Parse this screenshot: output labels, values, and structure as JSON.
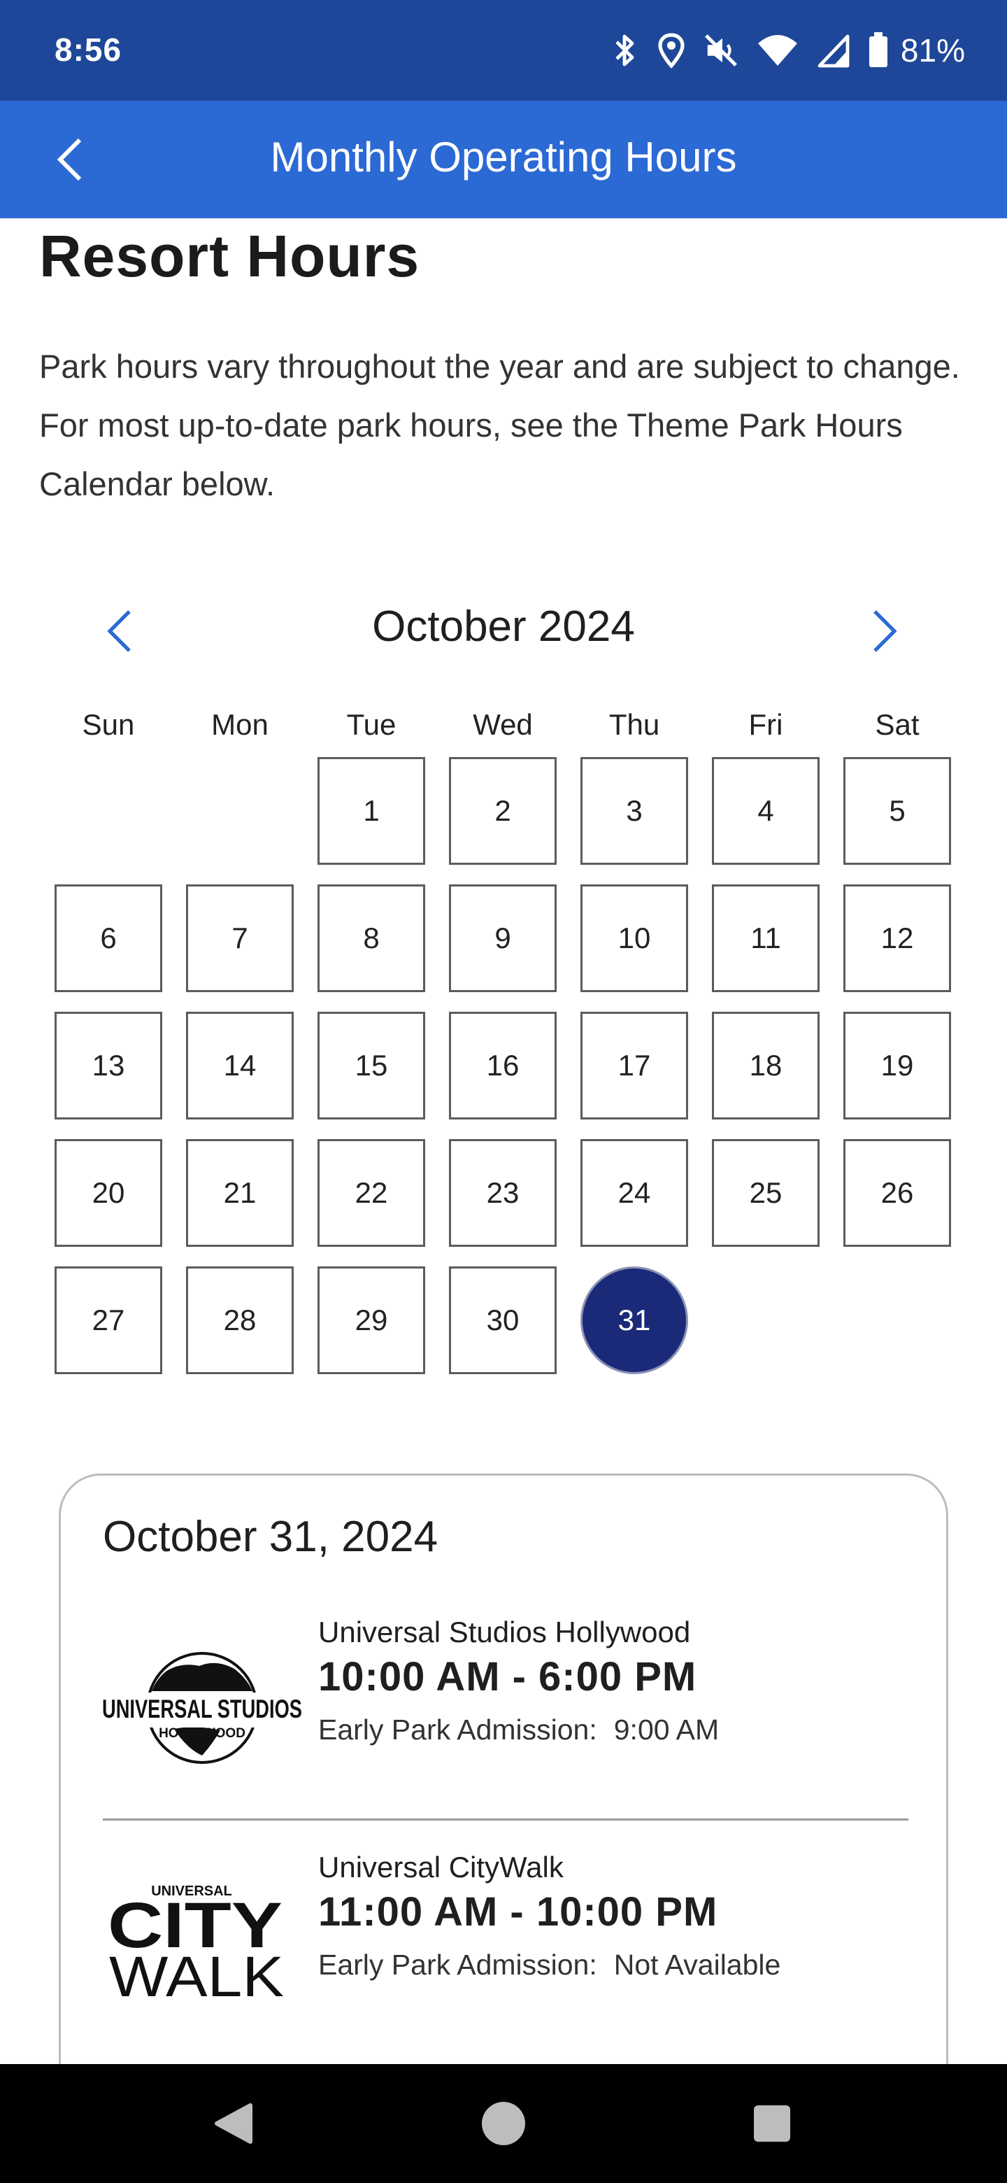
{
  "status_bar": {
    "time": "8:56",
    "battery": "81%",
    "icons": [
      "bluetooth-icon",
      "location-icon",
      "mute-icon",
      "wifi-icon",
      "signal-icon",
      "battery-icon"
    ]
  },
  "header": {
    "title": "Monthly Operating Hours",
    "back_icon": "chevron-left-icon"
  },
  "resort": {
    "title": "Resort Hours",
    "description": "Park hours vary throughout the year and are subject to change. For most up-to-date park hours, see the Theme Park Hours Calendar below."
  },
  "calendar": {
    "month_label": "October 2024",
    "weekdays": [
      "Sun",
      "Mon",
      "Tue",
      "Wed",
      "Thu",
      "Fri",
      "Sat"
    ],
    "first_weekday_index": 2,
    "days": [
      "1",
      "2",
      "3",
      "4",
      "5",
      "6",
      "7",
      "8",
      "9",
      "10",
      "11",
      "12",
      "13",
      "14",
      "15",
      "16",
      "17",
      "18",
      "19",
      "20",
      "21",
      "22",
      "23",
      "24",
      "25",
      "26",
      "27",
      "28",
      "29",
      "30",
      "31"
    ],
    "selected_day": "31",
    "selected_color": "#1a2a78"
  },
  "hours_card": {
    "date": "October 31, 2024",
    "parks": [
      {
        "logo": "universal-studios-hollywood-logo",
        "logo_text_main": "UNIVERSAL STUDIOS",
        "logo_text_sub": "HOLLYWOOD",
        "name": "Universal Studios Hollywood",
        "hours": "10:00 AM - 6:00 PM",
        "early_label": "Early Park Admission:",
        "early_value": "9:00 AM"
      },
      {
        "logo": "universal-citywalk-logo",
        "logo_text_top": "UNIVERSAL",
        "logo_text_city": "CITY",
        "logo_text_walk": "WALK",
        "name": "Universal CityWalk",
        "hours": "11:00 AM - 10:00 PM",
        "early_label": "Early Park Admission:",
        "early_value": "Not Available"
      }
    ]
  },
  "nav_bar": {
    "buttons": [
      "back-triangle-icon",
      "home-circle-icon",
      "recents-square-icon"
    ]
  },
  "colors": {
    "status_bar": "#1e4799",
    "header": "#2b69d4",
    "accent": "#2b69d4",
    "selected_day": "#1a2a78"
  }
}
